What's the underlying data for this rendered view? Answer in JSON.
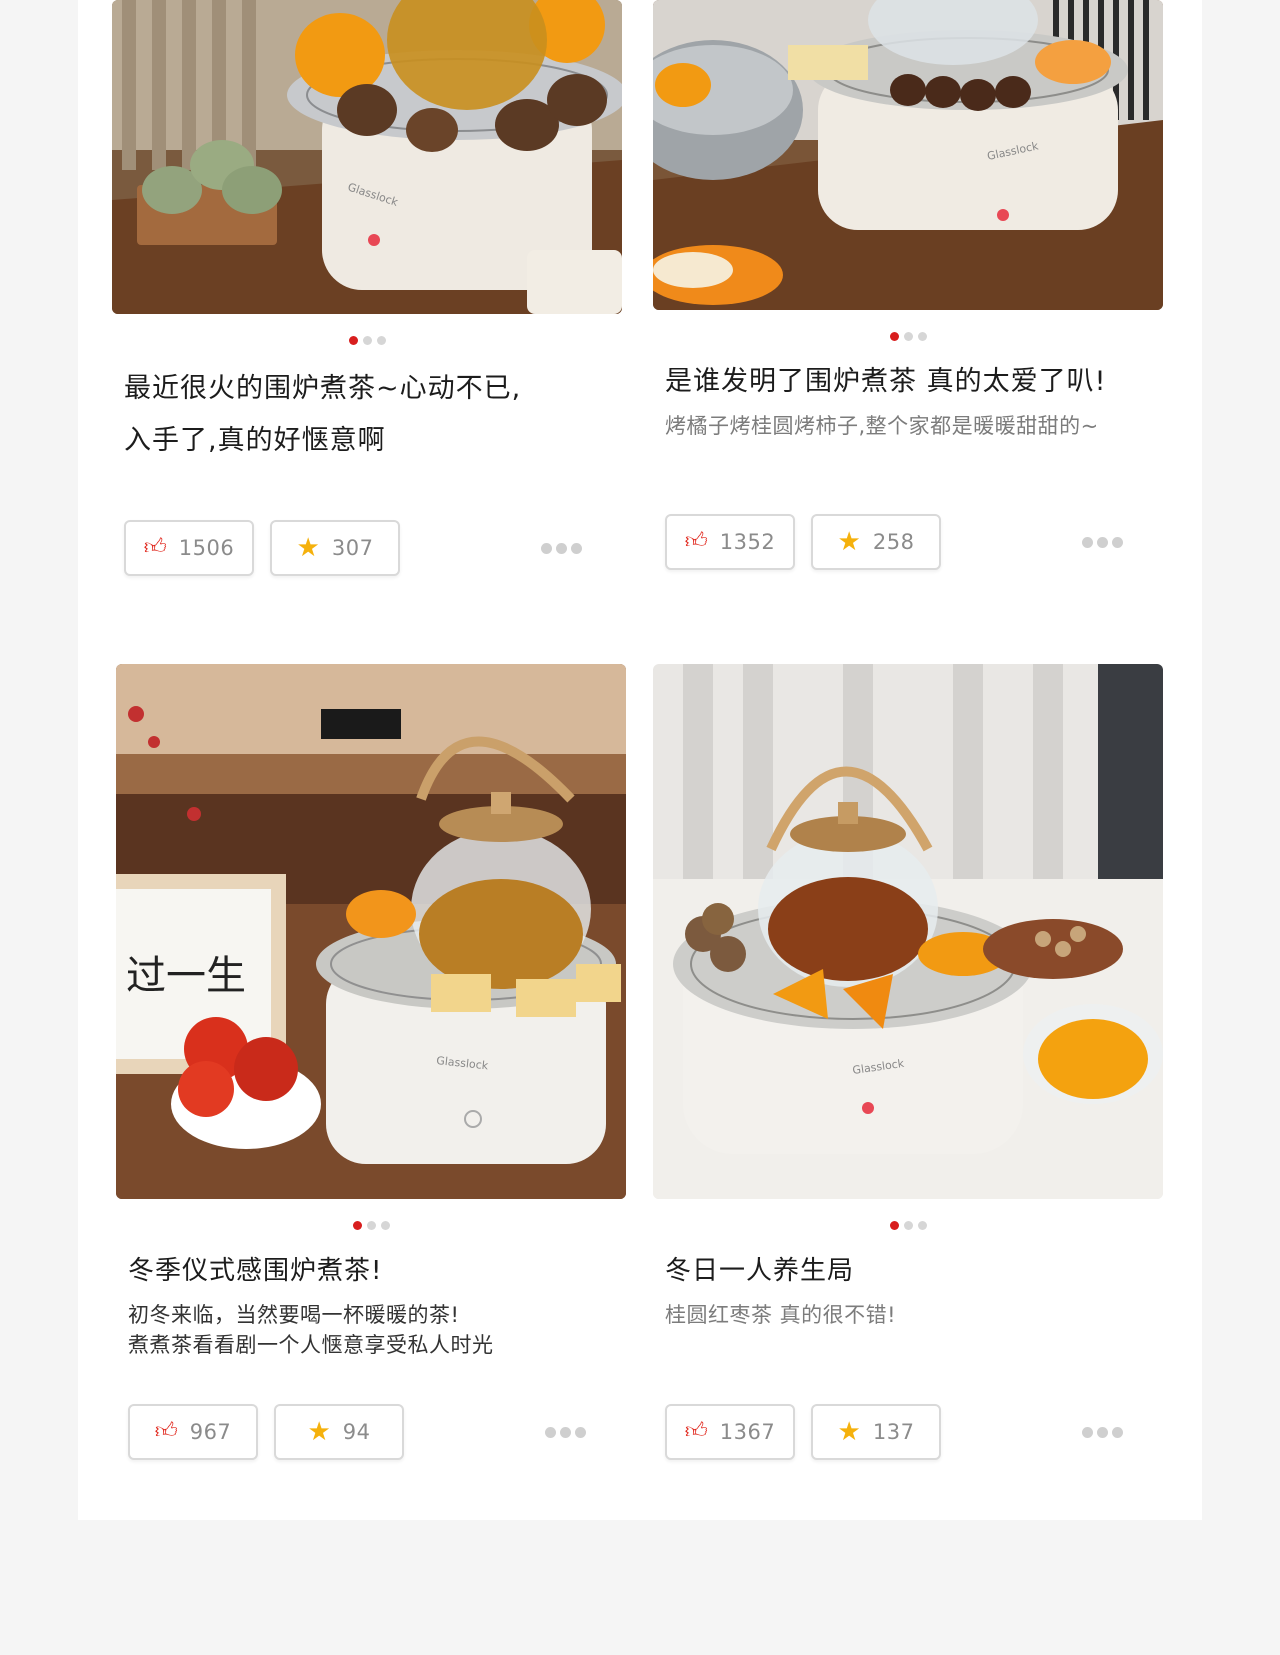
{
  "colors": {
    "accent_red": "#d81e1e",
    "star_yellow": "#f5b10c",
    "page_bg": "#f5f5f5",
    "card_bg": "#ffffff"
  },
  "cards": [
    {
      "image_desc": "Glasslock white tea stove with grill, glass teapot, oranges, chestnuts and green cakes on wooden table",
      "title": "最近很火的围炉煮茶~心动不已,\n入手了,真的好惬意啊",
      "subtitle": "",
      "likes": "1506",
      "stars": "307",
      "like_icon": "thumbs-up-icon",
      "star_icon": "star-icon",
      "more_icon": "more-dots-icon"
    },
    {
      "image_desc": "Glasslock white tea stove with grill, glass kettle, chestnuts, cakes and oranges, metal colander",
      "title": "是谁发明了围炉煮茶 真的太爱了叭!",
      "subtitle": "烤橘子烤桂圆烤柿子,整个家都是暖暖甜甜的~",
      "likes": "1352",
      "stars": "258",
      "like_icon": "thumbs-up-icon",
      "star_icon": "star-icon",
      "more_icon": "more-dots-icon"
    },
    {
      "image_desc": "Glass teapot with wooden handle on Glasslock stove, pastries, orange, calligraphy frame and red fruit bowl",
      "title": "冬季仪式感围炉煮茶!",
      "subtitle": "初冬来临，当然要喝一杯暖暖的茶!\n煮煮茶看看剧一个人惬意享受私人时光",
      "likes": "967",
      "stars": "94",
      "like_icon": "thumbs-up-icon",
      "star_icon": "star-icon",
      "more_icon": "more-dots-icon"
    },
    {
      "image_desc": "Glass teapot on Glasslock stove with longans, orange slices, dates and nuts, persimmon in glass bowl",
      "title": "冬日一人养生局",
      "subtitle": "桂圆红枣茶 真的很不错!",
      "likes": "1367",
      "stars": "137",
      "like_icon": "thumbs-up-icon",
      "star_icon": "star-icon",
      "more_icon": "more-dots-icon"
    }
  ]
}
